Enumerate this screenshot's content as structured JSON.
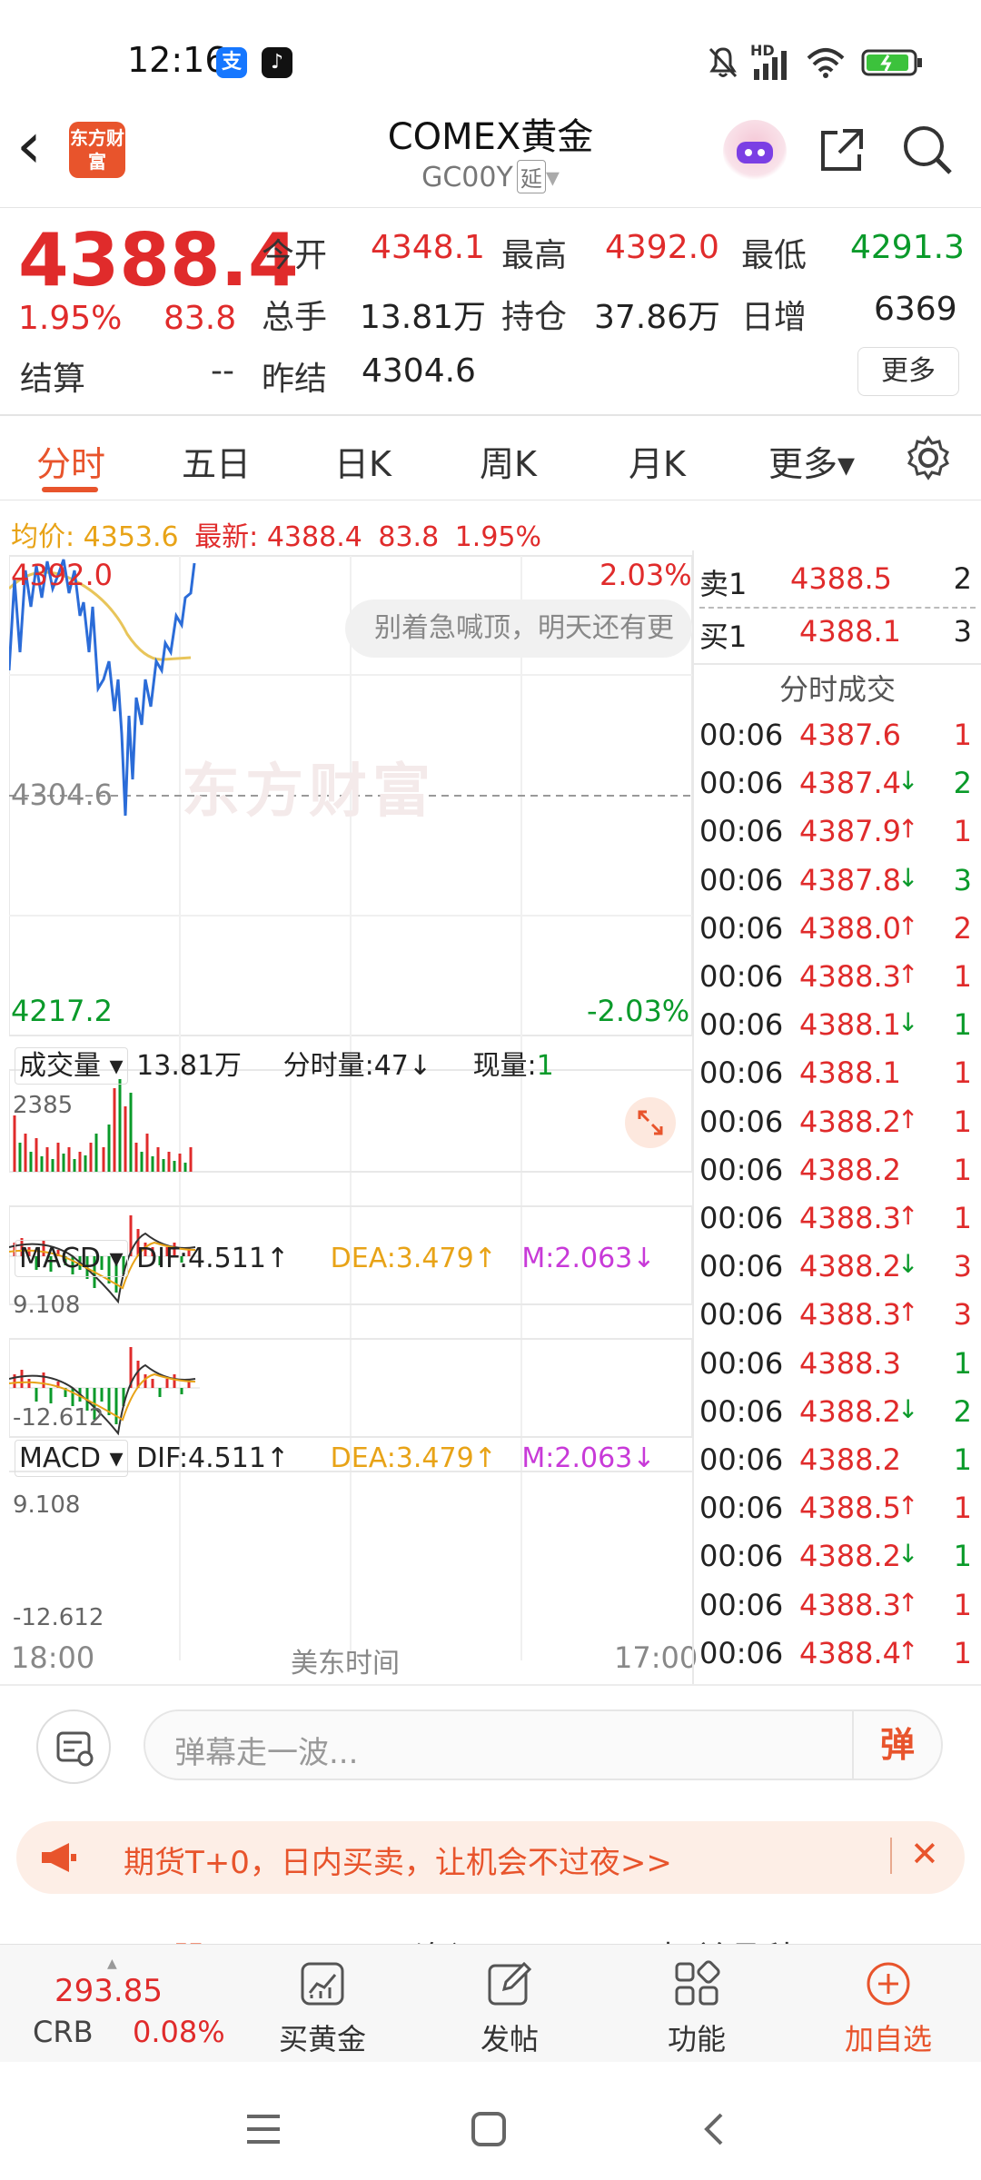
{
  "status_bar": {
    "time": "12:16",
    "hd": "HD"
  },
  "header": {
    "back": "‹",
    "logo": "东方财富",
    "title": "COMEX黄金",
    "code": "GC00Y",
    "delay_tag": "延",
    "dropdown": "▾"
  },
  "quote": {
    "price": "4388.4",
    "change_pct": "1.95%",
    "change": "83.8",
    "settle_label": "结算",
    "settle_value": "--",
    "open_label": "今开",
    "open": "4348.1",
    "high_label": "最高",
    "high": "4392.0",
    "low_label": "最低",
    "low": "4291.3",
    "volume_label": "总手",
    "volume": "13.81万",
    "oi_label": "持仓",
    "oi": "37.86万",
    "daily_inc_label": "日增",
    "daily_inc": "6369",
    "prev_settle_label": "昨结",
    "prev_settle": "4304.6",
    "more_button": "更多"
  },
  "tabs": [
    {
      "label": "分时"
    },
    {
      "label": "五日"
    },
    {
      "label": "日K"
    },
    {
      "label": "周K"
    },
    {
      "label": "月K"
    },
    {
      "label": "更多▾"
    }
  ],
  "avg_line": {
    "avg_label": "均价:",
    "avg_value": "4353.6",
    "latest_label": "最新:",
    "latest_value": "4388.4",
    "latest_change": "83.8",
    "latest_pct": "1.95%"
  },
  "chart": {
    "price_high": "4392.0",
    "pct_high": "2.03%",
    "price_mid": "4304.6",
    "price_low": "4217.2",
    "pct_low": "-2.03%",
    "bubble_text": "别着急喊顶，明天还有更",
    "watermark": "东方财富",
    "volume_label": "成交量 ▾",
    "volume_total": "13.81万",
    "minute_vol_label": "分时量:47↓",
    "current_vol_label": "现量:",
    "current_vol_value": "1",
    "vol_max": "2385",
    "macd_blocks": [
      {
        "name": "MACD ▾",
        "dif": "DIF:4.511↑",
        "dea": "DEA:3.479↑",
        "m": "M:2.063↓",
        "top": "9.108",
        "bottom": "-12.612"
      },
      {
        "name": "MACD ▾",
        "dif": "DIF:4.511↑",
        "dea": "DEA:3.479↑",
        "m": "M:2.063↓",
        "top": "9.108",
        "bottom": "-12.612"
      }
    ],
    "time_start": "18:00",
    "time_mid": "美东时间",
    "time_end": "17:00"
  },
  "orderbook": {
    "sell1_label": "卖1",
    "sell1_price": "4388.5",
    "sell1_qty": "2",
    "buy1_label": "买1",
    "buy1_price": "4388.1",
    "buy1_qty": "3",
    "trades_title": "分时成交"
  },
  "trades": [
    {
      "time": "00:06",
      "price": "4387.6",
      "dir": "",
      "qty": "1",
      "qcolor": "red"
    },
    {
      "time": "00:06",
      "price": "4387.4",
      "dir": "↓",
      "qty": "2",
      "qcolor": "green"
    },
    {
      "time": "00:06",
      "price": "4387.9",
      "dir": "↑",
      "qty": "1",
      "qcolor": "red"
    },
    {
      "time": "00:06",
      "price": "4387.8",
      "dir": "↓",
      "qty": "3",
      "qcolor": "green"
    },
    {
      "time": "00:06",
      "price": "4388.0",
      "dir": "↑",
      "qty": "2",
      "qcolor": "red"
    },
    {
      "time": "00:06",
      "price": "4388.3",
      "dir": "↑",
      "qty": "1",
      "qcolor": "red"
    },
    {
      "time": "00:06",
      "price": "4388.1",
      "dir": "↓",
      "qty": "1",
      "qcolor": "green"
    },
    {
      "time": "00:06",
      "price": "4388.1",
      "dir": "",
      "qty": "1",
      "qcolor": "red"
    },
    {
      "time": "00:06",
      "price": "4388.2",
      "dir": "↑",
      "qty": "1",
      "qcolor": "red"
    },
    {
      "time": "00:06",
      "price": "4388.2",
      "dir": "",
      "qty": "1",
      "qcolor": "red"
    },
    {
      "time": "00:06",
      "price": "4388.3",
      "dir": "↑",
      "qty": "1",
      "qcolor": "red"
    },
    {
      "time": "00:06",
      "price": "4388.2",
      "dir": "↓",
      "qty": "3",
      "qcolor": "red"
    },
    {
      "time": "00:06",
      "price": "4388.3",
      "dir": "↑",
      "qty": "3",
      "qcolor": "red"
    },
    {
      "time": "00:06",
      "price": "4388.3",
      "dir": "",
      "qty": "1",
      "qcolor": "green"
    },
    {
      "time": "00:06",
      "price": "4388.2",
      "dir": "↓",
      "qty": "2",
      "qcolor": "green"
    },
    {
      "time": "00:06",
      "price": "4388.2",
      "dir": "",
      "qty": "1",
      "qcolor": "green"
    },
    {
      "time": "00:06",
      "price": "4388.5",
      "dir": "↑",
      "qty": "1",
      "qcolor": "red"
    },
    {
      "time": "00:06",
      "price": "4388.2",
      "dir": "↓",
      "qty": "1",
      "qcolor": "green"
    },
    {
      "time": "00:06",
      "price": "4388.3",
      "dir": "↑",
      "qty": "1",
      "qcolor": "red"
    },
    {
      "time": "00:06",
      "price": "4388.4",
      "dir": "↑",
      "qty": "1",
      "qcolor": "red"
    }
  ],
  "comment_bar": {
    "placeholder": "弹幕走一波...",
    "danmu_button": "弹"
  },
  "banner": {
    "text": "期货T+0，日内买卖，让机会不过夜>>",
    "close": "✕"
  },
  "hidden_tabs": [
    "股吧",
    "资讯",
    "相关品种"
  ],
  "bottom_nav": {
    "index_value": "293.85",
    "index_name": "CRB",
    "index_pct": "0.08%",
    "items": [
      {
        "label": "买黄金",
        "icon": "chart-icon"
      },
      {
        "label": "发帖",
        "icon": "edit-icon"
      },
      {
        "label": "功能",
        "icon": "grid-icon"
      },
      {
        "label": "加自选",
        "icon": "add-icon"
      }
    ]
  },
  "colors": {
    "up": "#e02b2b",
    "down": "#0a9a2a",
    "accent": "#e8542c",
    "avg": "#e8a317",
    "macd_m": "#c83ad8"
  }
}
